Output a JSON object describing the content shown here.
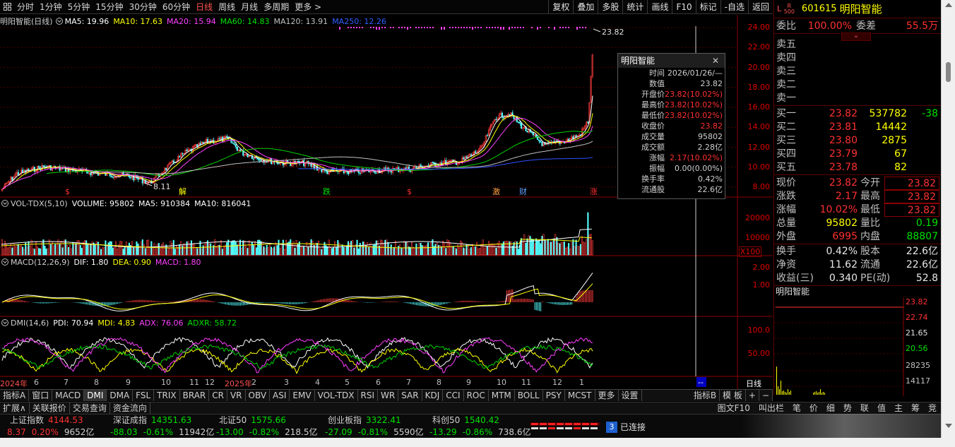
{
  "topbar": {
    "periods": [
      "分时",
      "1分钟",
      "5分钟",
      "15分钟",
      "30分钟",
      "60分钟",
      "日线",
      "周线",
      "月线",
      "多周期",
      "更多 >"
    ],
    "active_period": "日线",
    "buttons": [
      "复权",
      "叠加",
      "多股",
      "统计",
      "画线",
      "F10",
      "标记",
      "-自选",
      "返回"
    ]
  },
  "main_panel": {
    "title": "明阳智能(日线)",
    "ma": [
      {
        "label": "MA5: 19.96",
        "color": "#ffffff"
      },
      {
        "label": "MA10: 17.63",
        "color": "#ffff00"
      },
      {
        "label": "MA20: 15.94",
        "color": "#ff40ff"
      },
      {
        "label": "MA60: 14.83",
        "color": "#00e000"
      },
      {
        "label": "MA120: 13.91",
        "color": "#c0c0c0"
      },
      {
        "label": "MA250: 12.26",
        "color": "#3060ff"
      }
    ],
    "y_labels": [
      "24.00",
      "22.00",
      "20.00",
      "18.00",
      "16.00",
      "14.00",
      "12.00",
      "10.00",
      "8.00"
    ],
    "high_marker": "23.82",
    "low_marker": "8.11",
    "event_marks": [
      {
        "text": "$",
        "color": "#ff3030"
      },
      {
        "text": "解",
        "color": "#ffff00"
      },
      {
        "text": "跌",
        "color": "#00e000"
      },
      {
        "text": "$",
        "color": "#ff3030"
      },
      {
        "text": "激",
        "color": "#ffa040"
      },
      {
        "text": "财",
        "color": "#60a0ff"
      },
      {
        "text": "涨",
        "color": "#ff3030"
      }
    ]
  },
  "volume_panel": {
    "title": "VOL-TDX(5,10)",
    "items": [
      "VOLUME: 95802",
      "MA5: 910384",
      "MA10: 816041"
    ],
    "y_labels": [
      "20000",
      "10000"
    ],
    "unit": "X100"
  },
  "macd_panel": {
    "title": "MACD(12,26,9)",
    "items": [
      {
        "label": "DIF: 1.80",
        "color": "#ffffff"
      },
      {
        "label": "DEA: 0.90",
        "color": "#ffff00"
      },
      {
        "label": "MACD: 1.80",
        "color": "#ff40ff"
      }
    ],
    "y_labels": [
      "2.00",
      "1.00"
    ]
  },
  "dmi_panel": {
    "title": "DMI(14,6)",
    "items": [
      {
        "label": "PDI: 70.94",
        "color": "#ffffff"
      },
      {
        "label": "MDI: 4.83",
        "color": "#ffff00"
      },
      {
        "label": "ADX: 76.06",
        "color": "#ff40ff"
      },
      {
        "label": "ADXR: 58.72",
        "color": "#00e000"
      }
    ],
    "y_labels": [
      "100.0",
      "50.00"
    ]
  },
  "x_axis": {
    "labels": [
      "2024年",
      "6",
      "7",
      "8",
      "9",
      "10",
      "11",
      "12",
      "2025年",
      "2",
      "3",
      "4",
      "5",
      "6",
      "7",
      "8",
      "9",
      "10",
      "11",
      "12",
      "1"
    ],
    "cursor_label": "--",
    "period_label": "日线"
  },
  "tooltip": {
    "title": "明阳智能",
    "rows": [
      {
        "k": "时间",
        "v": "2026/01/26/—",
        "red": false
      },
      {
        "k": "数值",
        "v": "23.82",
        "red": false
      },
      {
        "k": "开盘价",
        "v": "23.82(10.02%)",
        "red": true
      },
      {
        "k": "最高价",
        "v": "23.82(10.02%)",
        "red": true
      },
      {
        "k": "最低价",
        "v": "23.82(10.02%)",
        "red": true
      },
      {
        "k": "收盘价",
        "v": "23.82",
        "red": true
      },
      {
        "k": "成交量",
        "v": "95802",
        "red": false
      },
      {
        "k": "成交额",
        "v": "2.28亿",
        "red": false
      },
      {
        "k": "涨幅",
        "v": "2.17(10.02%)",
        "red": true
      },
      {
        "k": "振幅",
        "v": "0.00(0.00%)",
        "red": false
      },
      {
        "k": "换手率",
        "v": "0.42%",
        "red": false
      },
      {
        "k": "流通股",
        "v": "22.6亿",
        "red": false
      }
    ]
  },
  "quote": {
    "flag_l": "L",
    "flag_r": "R",
    "flag_500": "500",
    "code": "601615",
    "name": "明阳智能",
    "weibi_label": "委比",
    "weibi": "100.00%",
    "weicha_label": "委差",
    "weicha": "55.5万",
    "sell": [
      {
        "label": "卖五",
        "price": "",
        "vol": ""
      },
      {
        "label": "卖四",
        "price": "",
        "vol": ""
      },
      {
        "label": "卖三",
        "price": "",
        "vol": ""
      },
      {
        "label": "卖二",
        "price": "",
        "vol": ""
      },
      {
        "label": "卖一",
        "price": "",
        "vol": ""
      }
    ],
    "buy": [
      {
        "label": "买一",
        "price": "23.82",
        "vol": "537782",
        "chg": "-38"
      },
      {
        "label": "买二",
        "price": "23.81",
        "vol": "14442",
        "chg": ""
      },
      {
        "label": "买三",
        "price": "23.80",
        "vol": "2875",
        "chg": ""
      },
      {
        "label": "买四",
        "price": "23.79",
        "vol": "67",
        "chg": ""
      },
      {
        "label": "买五",
        "price": "23.78",
        "vol": "82",
        "chg": ""
      }
    ],
    "stats": [
      {
        "a": "现价",
        "b": "23.82",
        "bc": "red",
        "c": "今开",
        "d": "23.82",
        "dc": "red"
      },
      {
        "a": "涨跌",
        "b": "2.17",
        "bc": "red",
        "c": "最高",
        "d": "23.82",
        "dc": "red"
      },
      {
        "a": "涨幅",
        "b": "10.02%",
        "bc": "red",
        "c": "最低",
        "d": "23.82",
        "dc": "red"
      },
      {
        "a": "总量",
        "b": "95802",
        "bc": "yellow",
        "c": "量比",
        "d": "0.19",
        "dc": "green"
      },
      {
        "a": "外盘",
        "b": "6995",
        "bc": "red",
        "c": "内盘",
        "d": "88807",
        "dc": "green"
      }
    ],
    "stats2": [
      {
        "a": "换手",
        "b": "0.42%",
        "c": "股本",
        "d": "22.6亿"
      },
      {
        "a": "净资",
        "b": "11.62",
        "c": "流通",
        "d": "22.6亿"
      },
      {
        "a": "收益(三)",
        "b": "0.340",
        "c": "PE(动)",
        "d": "52.8"
      }
    ],
    "mini_title": "明阳智能",
    "mini_labels": [
      {
        "t": "23.82",
        "c": "#ff3030"
      },
      {
        "t": "22.74",
        "c": "#ff3030"
      },
      {
        "t": "21.65",
        "c": "#e0e0e0"
      },
      {
        "t": "20.56",
        "c": "#00e000"
      },
      {
        "t": "28235",
        "c": "#c0c0c0"
      },
      {
        "t": "14117",
        "c": "#c0c0c0"
      }
    ]
  },
  "indicator_tabs": {
    "items": [
      "指标A",
      "窗口",
      "MACD",
      "DMI",
      "DMA",
      "FSL",
      "TRIX",
      "BRAR",
      "CR",
      "VR",
      "OBV",
      "ASI",
      "EMV",
      "VOL-TDX",
      "RSI",
      "WR",
      "SAR",
      "KDJ",
      "CCI",
      "ROC",
      "MTM",
      "BOLL",
      "PSY",
      "MCST",
      "更多",
      "设置"
    ],
    "right": [
      "指标B",
      "模 板",
      "+",
      "−"
    ]
  },
  "func_tabs": {
    "items": [
      "扩展∧",
      "关联报价",
      "交易查询",
      "资金流向"
    ],
    "right": [
      "图文F10",
      "叫出栏",
      "笔",
      "价",
      "细",
      "势",
      "联",
      "值",
      "主",
      "筹",
      "竞"
    ]
  },
  "status_bar": {
    "indices": [
      {
        "name": "上证指数",
        "value": "4144.53",
        "chg": "8.37",
        "pct": "0.20%",
        "amt": "9652亿",
        "up": true
      },
      {
        "name": "深证成指",
        "value": "14351.63",
        "chg": "-88.03",
        "pct": "-0.61%",
        "amt": "11942亿",
        "up": false
      },
      {
        "name": "北证50",
        "value": "1575.66",
        "chg": "-13.00",
        "pct": "-0.82%",
        "amt": "218.5亿",
        "up": false
      },
      {
        "name": "创业板指",
        "value": "3322.41",
        "chg": "-27.09",
        "pct": "-0.81%",
        "amt": "5590亿",
        "up": false
      },
      {
        "name": "科创50",
        "value": "1540.42",
        "chg": "-13.29",
        "pct": "-0.86%",
        "amt": "738.6亿",
        "up": false
      }
    ],
    "conn_num": "3",
    "conn_text": "已连接"
  }
}
